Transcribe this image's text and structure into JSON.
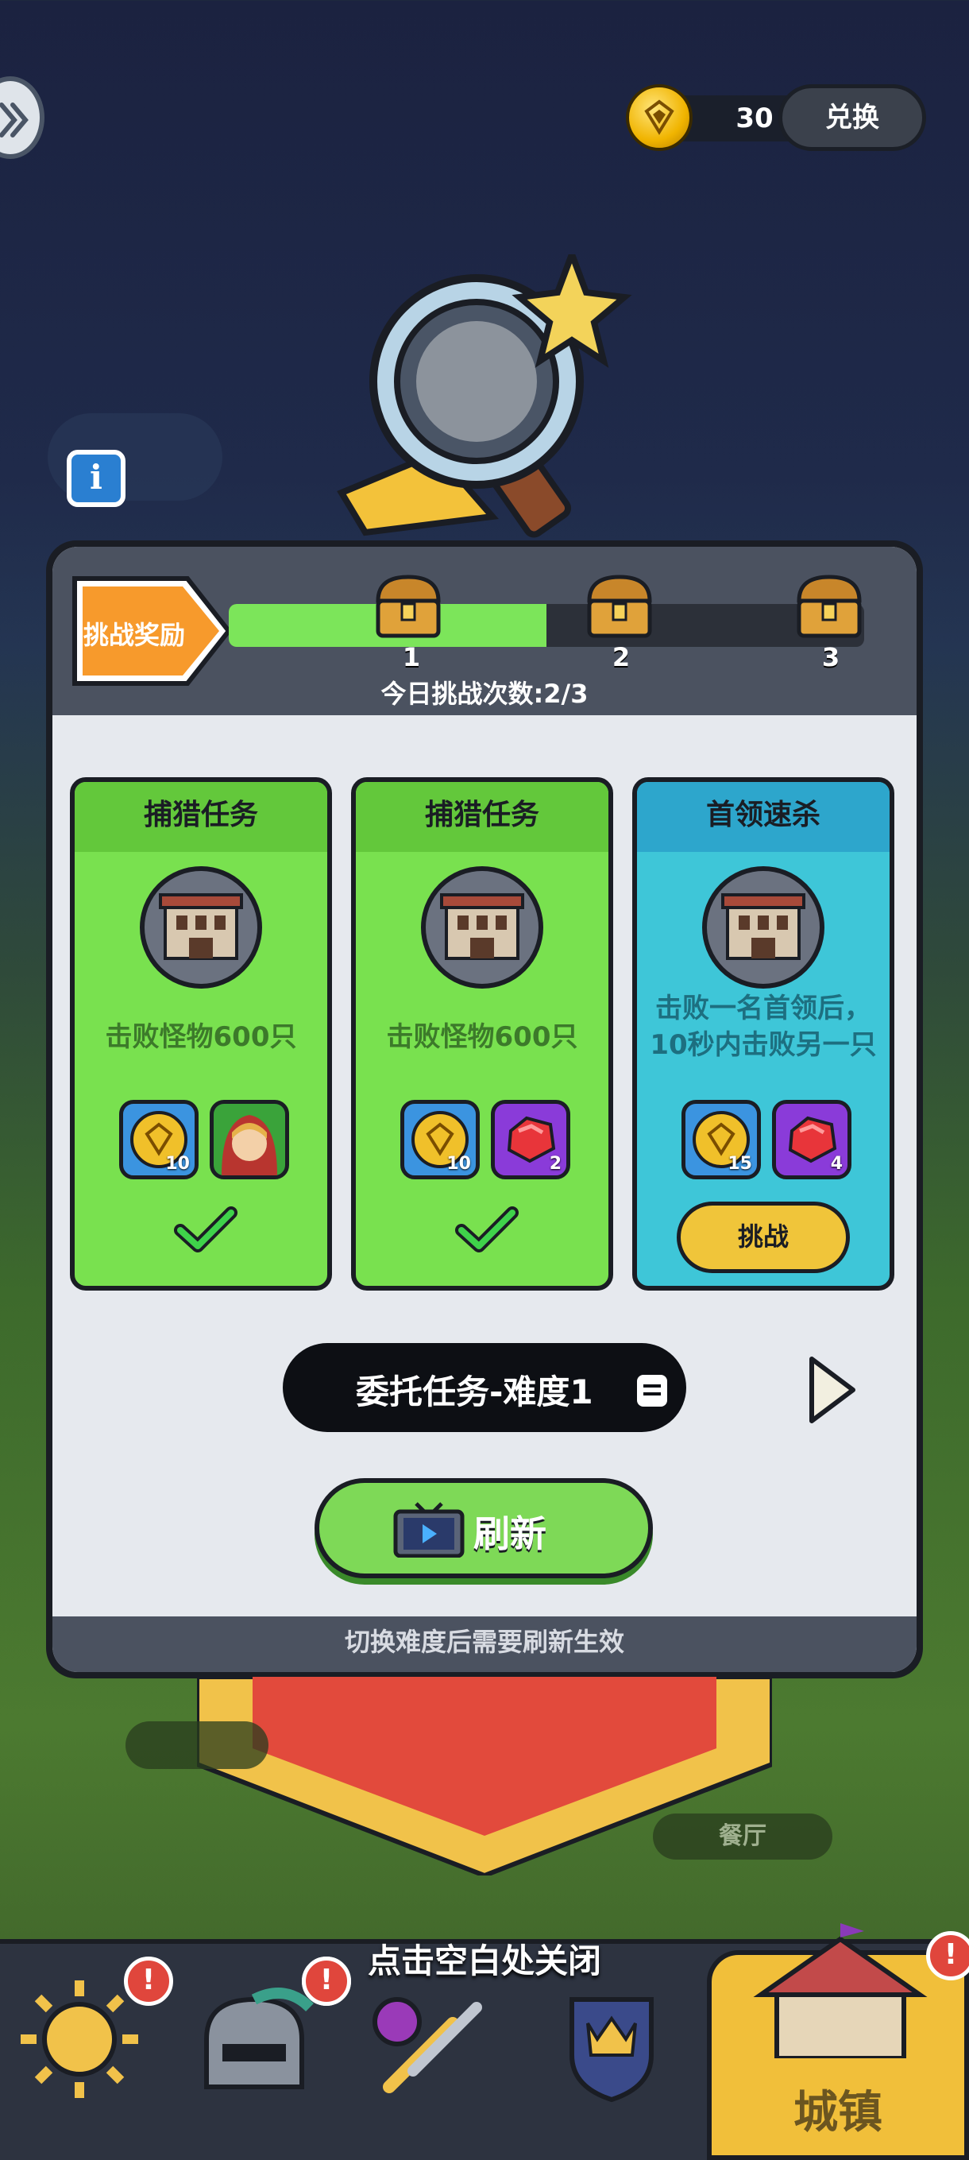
{
  "top_bar": {
    "currency_value": "30",
    "exchange_label": "兑换",
    "info_label": "i"
  },
  "panel": {
    "reward_tag": "挑战奖励",
    "progress": {
      "current": 2,
      "total": 3,
      "fraction": 0.5
    },
    "chests": [
      "1",
      "2",
      "3"
    ],
    "daily_count": "今日挑战次数:2/3",
    "cards": [
      {
        "title": "捕猎任务",
        "desc": "击败怪物600只",
        "rewards": [
          {
            "type": "coin",
            "count": "10"
          },
          {
            "type": "hero",
            "count": ""
          }
        ],
        "status": "completed",
        "accent": "#79e14f"
      },
      {
        "title": "捕猎任务",
        "desc": "击败怪物600只",
        "rewards": [
          {
            "type": "coin",
            "count": "10"
          },
          {
            "type": "gem",
            "count": "2"
          }
        ],
        "status": "completed",
        "accent": "#79e14f"
      },
      {
        "title": "首领速杀",
        "desc": "击败一名首领后，10秒内击败另一只",
        "rewards": [
          {
            "type": "coin",
            "count": "15"
          },
          {
            "type": "gem",
            "count": "4"
          }
        ],
        "status": "available",
        "button_label": "挑战",
        "accent": "#3ec6d8"
      }
    ],
    "difficulty_label": "委托任务-难度1",
    "refresh_label": "刷新",
    "footer_note": "切换难度后需要刷新生效"
  },
  "close_hint": "点击空白处关闭",
  "map_labels": {
    "restaurant": "餐厅"
  },
  "bottom_nav": {
    "items": [
      {
        "icon": "sun-icon",
        "badge": "!"
      },
      {
        "icon": "helmet-icon",
        "badge": "!"
      },
      {
        "icon": "weapon-icon",
        "badge": "!"
      },
      {
        "icon": "crown-shield-icon",
        "badge": ""
      },
      {
        "icon": "town-icon",
        "badge": "!",
        "label": "城镇",
        "active": true
      }
    ]
  },
  "colors": {
    "card_green": "#79e14f",
    "card_blue": "#3ec6d8",
    "progress_fill": "#7ce55a",
    "challenge_button": "#f0c53a",
    "badge_red": "#e0463c"
  }
}
